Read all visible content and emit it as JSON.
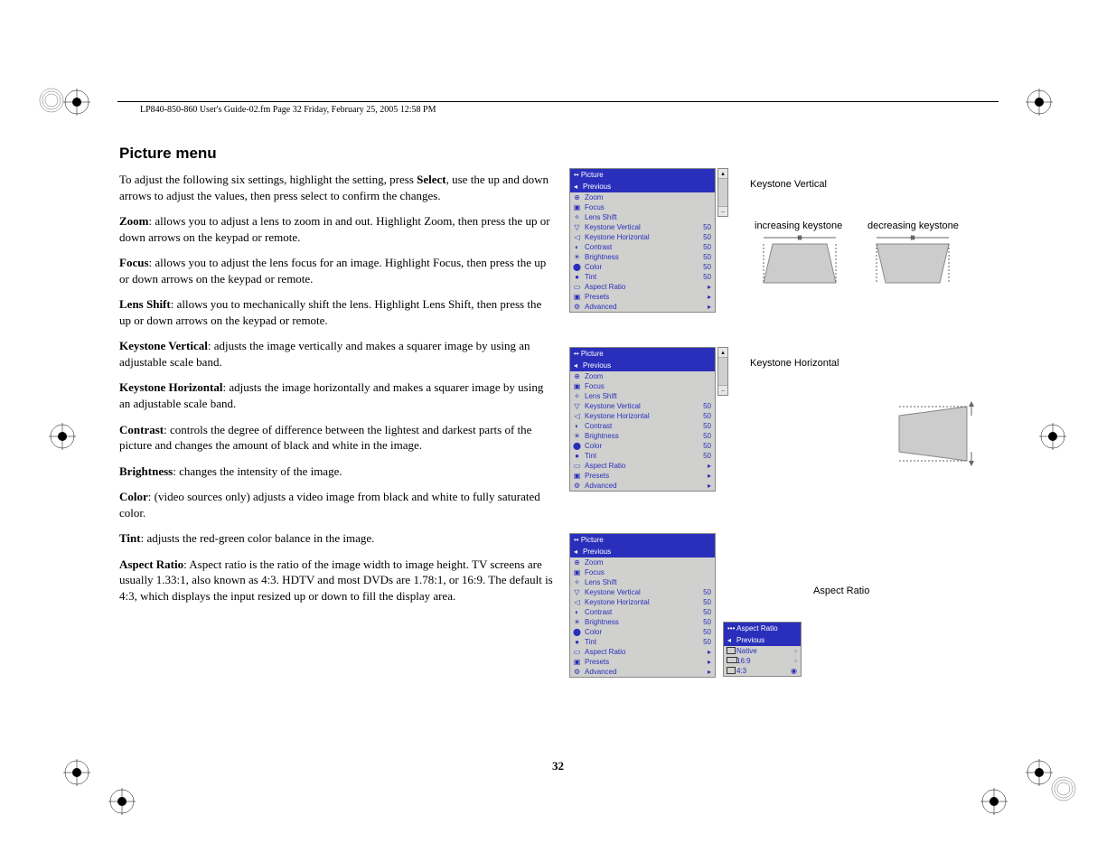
{
  "header": "LP840-850-860 User's Guide-02.fm  Page 32  Friday, February 25, 2005  12:58 PM",
  "page_number": "32",
  "heading": "Picture menu",
  "paragraphs": {
    "intro_a": "To adjust the following six settings, highlight the setting, press ",
    "intro_b": "Select",
    "intro_c": ", use the up and down arrows to adjust the values, then press select to confirm the changes.",
    "zoom_b": "Zoom",
    "zoom_t": ": allows you to adjust a lens to zoom in and out. Highlight Zoom, then press the up or down arrows on the keypad or remote.",
    "focus_b": "Focus",
    "focus_t": ": allows you to adjust the lens focus for an image. Highlight Focus, then press the up or down arrows on the keypad or remote.",
    "lens_b": "Lens Shift",
    "lens_t": ": allows you to mechanically shift the lens. Highlight Lens Shift, then press the up or down arrows on the keypad or remote.",
    "kv_b": "Keystone Vertical",
    "kv_t": ": adjusts the image vertically and makes a squarer image by using an adjustable scale band.",
    "kh_b": "Keystone Horizontal",
    "kh_t": ": adjusts the image horizontally and makes a squarer image by using an adjustable scale band.",
    "con_b": "Contrast",
    "con_t": ": controls the degree of difference between the lightest and darkest parts of the picture and changes the amount of black and white in the image.",
    "bri_b": "Brightness",
    "bri_t": ": changes the intensity of the image.",
    "col_b": "Color",
    "col_t": ": (video sources only) adjusts a video image from black and white to fully saturated color.",
    "tint_b": "Tint",
    "tint_t": ": adjusts the red-green color balance in the image.",
    "ar_b": "Aspect Ratio",
    "ar_t": ": Aspect ratio is the ratio of the image width to image height. TV screens are usually 1.33:1, also known as 4:3. HDTV and most DVDs are 1.78:1, or 16:9. The default is 4:3, which displays the input resized up or down to fill the display area."
  },
  "captions": {
    "kv": "Keystone Vertical",
    "inc": "increasing keystone",
    "dec": "decreasing keystone",
    "kh": "Keystone Horizontal",
    "ar": "Aspect Ratio"
  },
  "osd": {
    "title": "•• Picture",
    "previous": "Previous",
    "rows": [
      {
        "label": "Zoom",
        "val": "",
        "icon": "⊕"
      },
      {
        "label": "Focus",
        "val": "",
        "icon": "▣"
      },
      {
        "label": "Lens Shift",
        "val": "",
        "icon": "✧"
      },
      {
        "label": "Keystone Vertical",
        "val": "50",
        "icon": "▽"
      },
      {
        "label": "Keystone Horizontal",
        "val": "50",
        "icon": "◁"
      },
      {
        "label": "Contrast",
        "val": "50",
        "icon": "◐"
      },
      {
        "label": "Brightness",
        "val": "50",
        "icon": "☀"
      },
      {
        "label": "Color",
        "val": "50",
        "icon": "⬤"
      },
      {
        "label": "Tint",
        "val": "50",
        "icon": "●"
      },
      {
        "label": "Aspect Ratio",
        "val": "▸",
        "icon": "▭"
      },
      {
        "label": "Presets",
        "val": "▸",
        "icon": "▣"
      },
      {
        "label": "Advanced",
        "val": "▸",
        "icon": "⚙"
      }
    ]
  },
  "aspect_sub": {
    "title": "••• Aspect Ratio",
    "previous": "Previous",
    "rows": [
      {
        "label": "Native"
      },
      {
        "label": "16:9"
      },
      {
        "label": "4:3"
      }
    ]
  }
}
